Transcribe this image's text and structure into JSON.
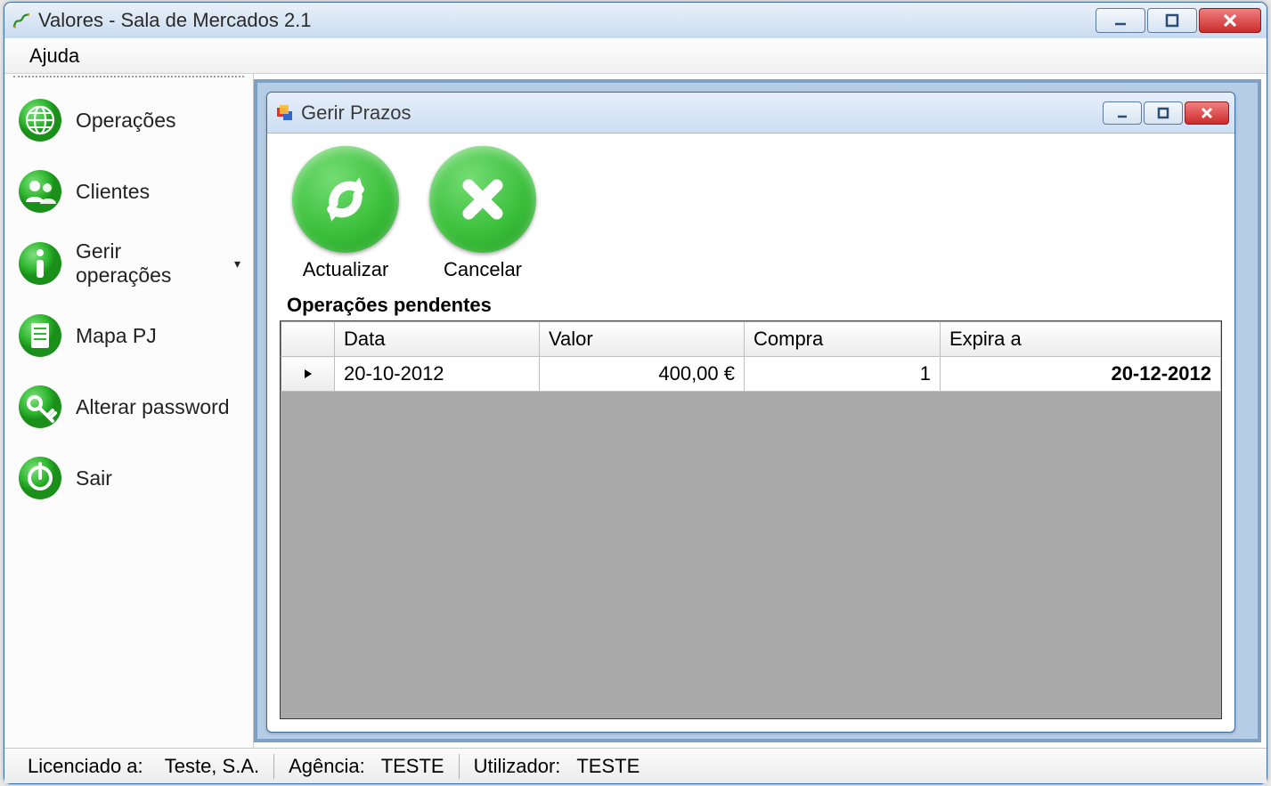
{
  "window": {
    "title": "Valores - Sala de Mercados 2.1"
  },
  "menubar": {
    "items": [
      "Ajuda"
    ]
  },
  "sidebar": {
    "items": [
      {
        "icon": "globe",
        "label": "Operações",
        "submenu": false
      },
      {
        "icon": "users",
        "label": "Clientes",
        "submenu": false
      },
      {
        "icon": "info",
        "label": "Gerir operações",
        "submenu": true
      },
      {
        "icon": "doc",
        "label": "Mapa PJ",
        "submenu": false
      },
      {
        "icon": "key",
        "label": "Alterar password",
        "submenu": false
      },
      {
        "icon": "power",
        "label": "Sair",
        "submenu": false
      }
    ]
  },
  "inner": {
    "title": "Gerir Prazos",
    "toolbar": {
      "refresh": "Actualizar",
      "cancel": "Cancelar"
    },
    "section_label": "Operações pendentes",
    "grid": {
      "headers": [
        "Data",
        "Valor",
        "Compra",
        "Expira a"
      ],
      "rows": [
        {
          "data": "20-10-2012",
          "valor": "400,00 €",
          "compra": "1",
          "expira": "20-12-2012"
        }
      ]
    }
  },
  "statusbar": {
    "license_label": "Licenciado a:",
    "license_value": "Teste, S.A.",
    "agency_label": "Agência:",
    "agency_value": "TESTE",
    "user_label": "Utilizador:",
    "user_value": "TESTE"
  }
}
